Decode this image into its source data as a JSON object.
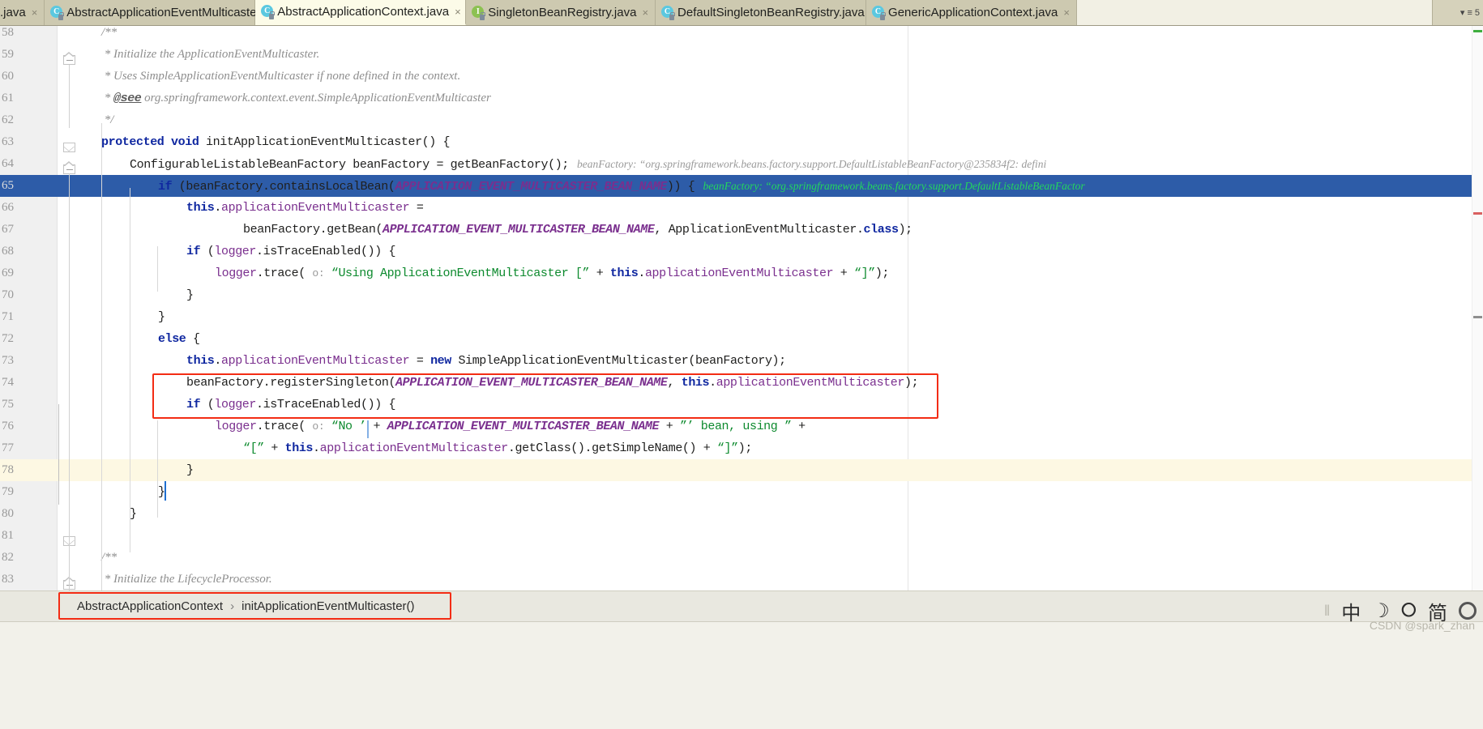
{
  "tabs": [
    {
      "label": ".java",
      "icon": "java-class-icon",
      "kind": "class",
      "active": false,
      "truncated": true
    },
    {
      "label": "AbstractApplicationEventMulticaster.java",
      "icon": "java-class-icon",
      "kind": "class",
      "active": false
    },
    {
      "label": "AbstractApplicationContext.java",
      "icon": "java-class-icon",
      "kind": "class",
      "active": true
    },
    {
      "label": "SingletonBeanRegistry.java",
      "icon": "java-interface-icon",
      "kind": "interface",
      "active": false
    },
    {
      "label": "DefaultSingletonBeanRegistry.java",
      "icon": "java-class-icon",
      "kind": "class",
      "active": false
    },
    {
      "label": "GenericApplicationContext.java",
      "icon": "java-class-icon",
      "kind": "class",
      "active": false
    }
  ],
  "tab_close_glyph": "×",
  "tabbar_right": {
    "chevron": "▾",
    "list_icon": "≡",
    "count": "5"
  },
  "editor": {
    "first_line": 58,
    "selected_line": 65,
    "caret_line": 78,
    "lines": [
      {
        "n": 58,
        "indent": 0,
        "tokens": [
          {
            "t": "cmt",
            "s": "/**"
          }
        ],
        "fold": "start"
      },
      {
        "n": 59,
        "indent": 0,
        "tokens": [
          {
            "t": "cmt",
            "s": " * Initialize the ApplicationEventMulticaster."
          }
        ]
      },
      {
        "n": 60,
        "indent": 0,
        "tokens": [
          {
            "t": "cmt",
            "s": " * Uses SimpleApplicationEventMulticaster if none defined in the context."
          }
        ]
      },
      {
        "n": 61,
        "indent": 0,
        "tokens": [
          {
            "t": "cmt",
            "s": " * "
          },
          {
            "t": "cmttag",
            "s": "@see"
          },
          {
            "t": "cmt",
            "s": " org.springframework.context.event.SimpleApplicationEventMulticaster"
          }
        ]
      },
      {
        "n": 62,
        "indent": 0,
        "tokens": [
          {
            "t": "cmt",
            "s": " */"
          }
        ],
        "fold": "end"
      },
      {
        "n": 63,
        "indent": 0,
        "tokens": [
          {
            "t": "kw",
            "s": "protected void"
          },
          {
            "t": "plain",
            "s": " initApplicationEventMulticaster() {"
          }
        ],
        "fold": "start"
      },
      {
        "n": 64,
        "indent": 1,
        "tokens": [
          {
            "t": "plain",
            "s": "ConfigurableListableBeanFactory beanFactory = getBeanFactory();"
          },
          {
            "t": "hint",
            "s": "   beanFactory: “org.springframework.beans.factory.support.DefaultListableBeanFactory@235834f2: defini"
          }
        ]
      },
      {
        "n": 65,
        "indent": 2,
        "selected": true,
        "tokens": [
          {
            "t": "kw",
            "s": "if"
          },
          {
            "t": "plain",
            "s": " (beanFactory.containsLocalBean("
          },
          {
            "t": "const",
            "s": "APPLICATION_EVENT_MULTICASTER_BEAN_NAME"
          },
          {
            "t": "plain",
            "s": ")) {"
          },
          {
            "t": "hintg",
            "s": "   beanFactory: “org.springframework.beans.factory.support.DefaultListableBeanFactor"
          }
        ]
      },
      {
        "n": 66,
        "indent": 3,
        "tokens": [
          {
            "t": "kw",
            "s": "this"
          },
          {
            "t": "plain",
            "s": "."
          },
          {
            "t": "pfield",
            "s": "applicationEventMulticaster"
          },
          {
            "t": "plain",
            "s": " ="
          }
        ]
      },
      {
        "n": 67,
        "indent": 5,
        "tokens": [
          {
            "t": "plain",
            "s": "beanFactory.getBean("
          },
          {
            "t": "const",
            "s": "APPLICATION_EVENT_MULTICASTER_BEAN_NAME"
          },
          {
            "t": "plain",
            "s": ", ApplicationEventMulticaster."
          },
          {
            "t": "kw",
            "s": "class"
          },
          {
            "t": "plain",
            "s": ");"
          }
        ]
      },
      {
        "n": 68,
        "indent": 3,
        "tokens": [
          {
            "t": "kw",
            "s": "if"
          },
          {
            "t": "plain",
            "s": " ("
          },
          {
            "t": "pfield",
            "s": "logger"
          },
          {
            "t": "plain",
            "s": ".isTraceEnabled()) {"
          }
        ]
      },
      {
        "n": 69,
        "indent": 4,
        "tokens": [
          {
            "t": "pfield",
            "s": "logger"
          },
          {
            "t": "plain",
            "s": ".trace( "
          },
          {
            "t": "phint",
            "s": "o:"
          },
          {
            "t": "plain",
            "s": " "
          },
          {
            "t": "str",
            "s": "“Using ApplicationEventMulticaster [”"
          },
          {
            "t": "plain",
            "s": " + "
          },
          {
            "t": "kw",
            "s": "this"
          },
          {
            "t": "plain",
            "s": "."
          },
          {
            "t": "pfield",
            "s": "applicationEventMulticaster"
          },
          {
            "t": "plain",
            "s": " + "
          },
          {
            "t": "str",
            "s": "“]”"
          },
          {
            "t": "plain",
            "s": ");"
          }
        ]
      },
      {
        "n": 70,
        "indent": 3,
        "tokens": [
          {
            "t": "plain",
            "s": "}"
          }
        ]
      },
      {
        "n": 71,
        "indent": 2,
        "tokens": [
          {
            "t": "plain",
            "s": "}"
          }
        ]
      },
      {
        "n": 72,
        "indent": 2,
        "tokens": [
          {
            "t": "kw",
            "s": "else"
          },
          {
            "t": "plain",
            "s": " {"
          }
        ]
      },
      {
        "n": 73,
        "indent": 3,
        "tokens": [
          {
            "t": "kw",
            "s": "this"
          },
          {
            "t": "plain",
            "s": "."
          },
          {
            "t": "pfield",
            "s": "applicationEventMulticaster"
          },
          {
            "t": "plain",
            "s": " = "
          },
          {
            "t": "kw",
            "s": "new"
          },
          {
            "t": "plain",
            "s": " SimpleApplicationEventMulticaster(beanFactory);"
          }
        ]
      },
      {
        "n": 74,
        "indent": 3,
        "tokens": [
          {
            "t": "plain",
            "s": "beanFactory.registerSingleton("
          },
          {
            "t": "const",
            "s": "APPLICATION_EVENT_MULTICASTER_BEAN_NAME"
          },
          {
            "t": "plain",
            "s": ", "
          },
          {
            "t": "kw",
            "s": "this"
          },
          {
            "t": "plain",
            "s": "."
          },
          {
            "t": "pfield",
            "s": "applicationEventMulticaster"
          },
          {
            "t": "plain",
            "s": ");"
          }
        ]
      },
      {
        "n": 75,
        "indent": 3,
        "tokens": [
          {
            "t": "kw",
            "s": "if"
          },
          {
            "t": "plain",
            "s": " ("
          },
          {
            "t": "pfield",
            "s": "logger"
          },
          {
            "t": "plain",
            "s": ".isTraceEnabled()) {"
          }
        ]
      },
      {
        "n": 76,
        "indent": 4,
        "tokens": [
          {
            "t": "pfield",
            "s": "logger"
          },
          {
            "t": "plain",
            "s": ".trace( "
          },
          {
            "t": "phint",
            "s": "o:"
          },
          {
            "t": "plain",
            "s": " "
          },
          {
            "t": "str",
            "s": "“No ’"
          },
          {
            "t": "plain",
            "s": " + "
          },
          {
            "t": "const",
            "s": "APPLICATION_EVENT_MULTICASTER_BEAN_NAME"
          },
          {
            "t": "plain",
            "s": " + "
          },
          {
            "t": "str",
            "s": "”’ bean, using ”"
          },
          {
            "t": "plain",
            "s": " +"
          }
        ]
      },
      {
        "n": 77,
        "indent": 5,
        "tokens": [
          {
            "t": "str",
            "s": "“[”"
          },
          {
            "t": "plain",
            "s": " + "
          },
          {
            "t": "kw",
            "s": "this"
          },
          {
            "t": "plain",
            "s": "."
          },
          {
            "t": "pfield",
            "s": "applicationEventMulticaster"
          },
          {
            "t": "plain",
            "s": ".getClass().getSimpleName() + "
          },
          {
            "t": "str",
            "s": "“]”"
          },
          {
            "t": "plain",
            "s": ");"
          }
        ]
      },
      {
        "n": 78,
        "indent": 3,
        "caret": true,
        "tokens": [
          {
            "t": "plain",
            "s": "}"
          }
        ]
      },
      {
        "n": 79,
        "indent": 2,
        "tokens": [
          {
            "t": "plain",
            "s": "}"
          }
        ]
      },
      {
        "n": 80,
        "indent": 1,
        "tokens": [
          {
            "t": "plain",
            "s": "}"
          }
        ],
        "fold": "end"
      },
      {
        "n": 81,
        "indent": 0,
        "tokens": []
      },
      {
        "n": 82,
        "indent": 0,
        "tokens": [
          {
            "t": "cmt",
            "s": "/**"
          }
        ],
        "fold": "start"
      },
      {
        "n": 83,
        "indent": 0,
        "tokens": [
          {
            "t": "cmt",
            "s": " * Initialize the LifecycleProcessor."
          }
        ]
      }
    ]
  },
  "breadcrumb": {
    "items": [
      "AbstractApplicationContext",
      "initApplicationEventMulticaster()"
    ],
    "separator": "›"
  },
  "tray": {
    "separator": "‖",
    "ime_lang": "中",
    "moon_icon": "☽",
    "mic_icon": "⭘",
    "simplified": "简",
    "gear_icon": "gear-icon"
  },
  "watermark": "CSDN @spark_zhan",
  "colors": {
    "selection_blue": "#2d5ca8",
    "caret_line": "#fdf8e3",
    "annotation_red": "#f32c14",
    "keyword": "#0f27a0",
    "string": "#0d8a2e",
    "constant_purple": "#7a2f8e",
    "comment_gray": "#8e8e8e",
    "inline_hint_gray": "#9a9a9a",
    "inline_hint_green": "#24d65e",
    "tab_active_bg": "#fcfbe8",
    "tab_inactive_bg": "#cdc9b0"
  }
}
